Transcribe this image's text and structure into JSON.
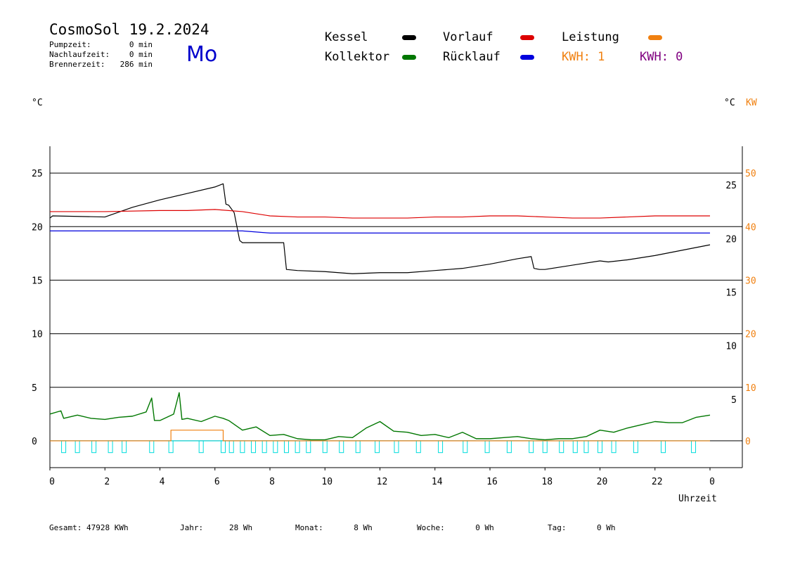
{
  "header": {
    "title": "CosmoSol 19.2.2024",
    "day": "Mo",
    "stats": [
      {
        "label": "Pumpzeit:",
        "value": "0 min"
      },
      {
        "label": "Nachlaufzeit:",
        "value": "0 min"
      },
      {
        "label": "Brennerzeit:",
        "value": "286 min"
      }
    ]
  },
  "legend": {
    "kessel": {
      "label": "Kessel",
      "color": "#000000"
    },
    "vorlauf": {
      "label": "Vorlauf",
      "color": "#dd0000"
    },
    "leistung": {
      "label": "Leistung",
      "color": "#f08010"
    },
    "kollektor": {
      "label": "Kollektor",
      "color": "#007700"
    },
    "ruecklauf": {
      "label": "Rücklauf",
      "color": "#0000dd"
    },
    "kwh1": {
      "label": "KWH: 1",
      "color": "#f08010"
    },
    "kwh2": {
      "label": "KWH: 0",
      "color": "#800080"
    }
  },
  "axes": {
    "left_unit": "°C",
    "right_unit": "°C",
    "right_unit2": "KW",
    "x_label": "Uhrzeit"
  },
  "footer": [
    {
      "label": "Gesamt:",
      "value": "47928 KWh"
    },
    {
      "label": "Jahr:",
      "value": "28 Wh"
    },
    {
      "label": "Monat:",
      "value": "8 Wh"
    },
    {
      "label": "Woche:",
      "value": "0 Wh"
    },
    {
      "label": "Tag:",
      "value": "0 Wh"
    }
  ],
  "chart_data": {
    "type": "line",
    "xlabel": "Uhrzeit",
    "ylabel": "°C",
    "xlim": [
      0,
      24
    ],
    "ylim": [
      -2.5,
      27.5
    ],
    "y2lim": [
      -5,
      55
    ],
    "x_ticks": [
      "0",
      "2",
      "4",
      "6",
      "8",
      "10",
      "12",
      "14",
      "16",
      "18",
      "20",
      "22",
      "0"
    ],
    "y_ticks_left": [
      "25",
      "20",
      "15",
      "10",
      "5",
      "0"
    ],
    "y_ticks_right_c": [
      "25",
      "20",
      "15",
      "10",
      "5"
    ],
    "y_ticks_right_kw": [
      "50",
      "40",
      "30",
      "20",
      "10",
      "0"
    ],
    "series": [
      {
        "name": "Kessel",
        "color": "#000000",
        "x": [
          0,
          0.1,
          2,
          3,
          4,
          5,
          6,
          6.3,
          6.4,
          6.5,
          6.7,
          6.8,
          6.9,
          7,
          7.1,
          8.5,
          8.6,
          9,
          10,
          11,
          12,
          13,
          14,
          15,
          16,
          17,
          17.5,
          17.6,
          17.8,
          18,
          19,
          20,
          20.3,
          21,
          22,
          23,
          24
        ],
        "y": [
          20.8,
          21.0,
          20.9,
          21.8,
          22.5,
          23.1,
          23.7,
          24.0,
          22.1,
          22.0,
          21.3,
          20.0,
          18.7,
          18.5,
          18.5,
          18.5,
          16.0,
          15.9,
          15.8,
          15.6,
          15.7,
          15.7,
          15.9,
          16.1,
          16.5,
          17.0,
          17.2,
          16.1,
          16.0,
          16.0,
          16.4,
          16.8,
          16.7,
          16.9,
          17.3,
          17.8,
          18.3
        ]
      },
      {
        "name": "Vorlauf",
        "color": "#dd0000",
        "x": [
          0,
          2,
          4,
          5,
          6,
          7,
          8,
          9,
          10,
          11,
          12,
          13,
          14,
          15,
          16,
          17,
          18,
          19,
          20,
          21,
          22,
          23,
          24
        ],
        "y": [
          21.4,
          21.4,
          21.5,
          21.5,
          21.6,
          21.4,
          21.0,
          20.9,
          20.9,
          20.8,
          20.8,
          20.8,
          20.9,
          20.9,
          21.0,
          21.0,
          20.9,
          20.8,
          20.8,
          20.9,
          21.0,
          21.0,
          21.0
        ]
      },
      {
        "name": "Rücklauf",
        "color": "#0000dd",
        "x": [
          0,
          6,
          7,
          8,
          10,
          12,
          14,
          16,
          18,
          20,
          22,
          24
        ],
        "y": [
          19.6,
          19.6,
          19.6,
          19.4,
          19.4,
          19.4,
          19.4,
          19.4,
          19.4,
          19.4,
          19.4,
          19.4
        ]
      },
      {
        "name": "Kollektor",
        "color": "#007700",
        "x": [
          0,
          0.4,
          0.5,
          1,
          1.5,
          2,
          2.5,
          3,
          3.5,
          3.7,
          3.8,
          4,
          4.5,
          4.7,
          4.8,
          5,
          5.5,
          6,
          6.3,
          6.5,
          7,
          7.5,
          8,
          8.5,
          9,
          9.5,
          10,
          10.5,
          11,
          11.5,
          12,
          12.5,
          13,
          13.5,
          14,
          14.5,
          15,
          15.5,
          16,
          16.5,
          17,
          17.5,
          18,
          18.5,
          19,
          19.5,
          20,
          20.5,
          21,
          21.5,
          22,
          22.5,
          23,
          23.5,
          24
        ],
        "y": [
          2.5,
          2.8,
          2.1,
          2.4,
          2.1,
          2.0,
          2.2,
          2.3,
          2.7,
          4.0,
          1.9,
          1.9,
          2.5,
          4.5,
          2.0,
          2.1,
          1.8,
          2.3,
          2.1,
          1.9,
          1.0,
          1.3,
          0.5,
          0.6,
          0.2,
          0.1,
          0.1,
          0.4,
          0.3,
          1.2,
          1.8,
          0.9,
          0.8,
          0.5,
          0.6,
          0.3,
          0.8,
          0.2,
          0.2,
          0.3,
          0.4,
          0.2,
          0.1,
          0.2,
          0.2,
          0.4,
          1.0,
          0.8,
          1.2,
          1.5,
          1.8,
          1.7,
          1.7,
          2.2,
          2.4
        ]
      },
      {
        "name": "Leistung",
        "color": "#f08010",
        "x": [
          0,
          4.4,
          4.4,
          6.3,
          6.3,
          24
        ],
        "y": [
          0,
          0,
          1.0,
          1.0,
          0,
          0
        ]
      }
    ],
    "pump_pulses_h": [
      0.5,
      1.0,
      1.6,
      2.2,
      2.7,
      3.7,
      4.4,
      5.5,
      6.3,
      6.6,
      7.0,
      7.4,
      7.8,
      8.2,
      8.6,
      9.0,
      9.4,
      10.0,
      10.6,
      11.2,
      11.9,
      12.6,
      13.4,
      14.2,
      15.1,
      15.9,
      16.7,
      17.5,
      18.0,
      18.6,
      19.1,
      19.5,
      20.0,
      20.5,
      21.3,
      22.3,
      23.4
    ]
  }
}
